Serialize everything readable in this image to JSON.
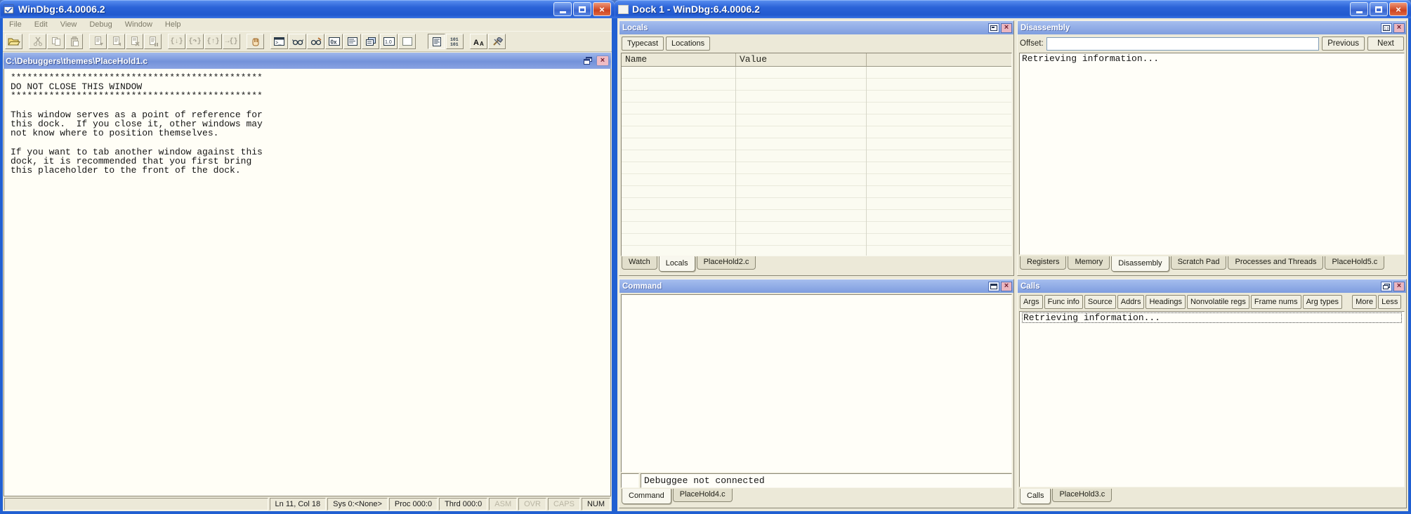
{
  "colors": {
    "titlebar_blue": "#2160d2",
    "panel_caption_blue": "#8faade",
    "chrome_tan": "#ece9d8",
    "close_red": "#d6553d",
    "content_white": "#fffef6"
  },
  "left_window": {
    "title": "WinDbg:6.4.0006.2",
    "menu": [
      "File",
      "Edit",
      "View",
      "Debug",
      "Window",
      "Help"
    ],
    "toolbar": [
      {
        "name": "open-source-file-icon",
        "enabled": true
      },
      {
        "name": "cut-icon",
        "enabled": false
      },
      {
        "name": "copy-icon",
        "enabled": false
      },
      {
        "name": "paste-icon",
        "enabled": false
      },
      {
        "name": "go-icon",
        "enabled": false
      },
      {
        "name": "restart-icon",
        "enabled": false
      },
      {
        "name": "stop-debugging-icon",
        "enabled": false
      },
      {
        "name": "break-icon",
        "enabled": false
      },
      {
        "name": "step-into-icon",
        "enabled": false
      },
      {
        "name": "step-over-icon",
        "enabled": false
      },
      {
        "name": "step-out-icon",
        "enabled": false
      },
      {
        "name": "run-to-cursor-icon",
        "enabled": false
      },
      {
        "name": "breakpoint-hand-icon",
        "enabled": true
      },
      {
        "name": "command-window-icon",
        "enabled": true
      },
      {
        "name": "watch-window-icon",
        "enabled": true
      },
      {
        "name": "locals-window-icon",
        "enabled": true
      },
      {
        "name": "memory-window-icon",
        "enabled": true
      },
      {
        "name": "registers-window-icon",
        "enabled": true
      },
      {
        "name": "call-stack-window-icon",
        "enabled": true
      },
      {
        "name": "float-registers-window-icon",
        "enabled": true
      },
      {
        "name": "scratch-pad-window-icon",
        "enabled": true
      },
      {
        "name": "source-mode-icon",
        "enabled": true
      },
      {
        "name": "memory-101-icon",
        "enabled": true
      },
      {
        "name": "font-icon",
        "enabled": true
      },
      {
        "name": "options-icon",
        "enabled": true
      }
    ],
    "document": {
      "title": "C:\\Debuggers\\themes\\PlaceHold1.c",
      "text": "**********************************************\nDO NOT CLOSE THIS WINDOW\n**********************************************\n\nThis window serves as a point of reference for\nthis dock.  If you close it, other windows may\nnot know where to position themselves.\n\nIf you want to tab another window against this\ndock, it is recommended that you first bring\nthis placeholder to the front of the dock."
    },
    "status": [
      "Ln 11, Col 18",
      "Sys 0:<None>",
      "Proc 000:0",
      "Thrd 000:0",
      "ASM",
      "OVR",
      "CAPS",
      "NUM"
    ]
  },
  "right_window": {
    "title": "Dock 1 - WinDbg:6.4.0006.2",
    "locals": {
      "title": "Locals",
      "typecast_button": "Typecast",
      "locations_button": "Locations",
      "columns": [
        "Name",
        "Value"
      ],
      "tabs": [
        "Watch",
        "Locals",
        "PlaceHold2.c"
      ],
      "active_tab": "Locals"
    },
    "command": {
      "title": "Command",
      "status_text": "Debuggee not connected",
      "tabs": [
        "Command",
        "PlaceHold4.c"
      ],
      "active_tab": "Command"
    },
    "disassembly": {
      "title": "Disassembly",
      "offset_label": "Offset:",
      "offset_value": "",
      "previous_button": "Previous",
      "next_button": "Next",
      "content": "Retrieving information...",
      "tabs": [
        "Registers",
        "Memory",
        "Disassembly",
        "Scratch Pad",
        "Processes and Threads",
        "PlaceHold5.c"
      ],
      "active_tab": "Disassembly"
    },
    "calls": {
      "title": "Calls",
      "buttons": [
        "Args",
        "Func info",
        "Source",
        "Addrs",
        "Headings",
        "Nonvolatile regs",
        "Frame nums",
        "Arg types",
        "More",
        "Less"
      ],
      "content": "Retrieving information...",
      "tabs": [
        "Calls",
        "PlaceHold3.c"
      ],
      "active_tab": "Calls"
    }
  }
}
